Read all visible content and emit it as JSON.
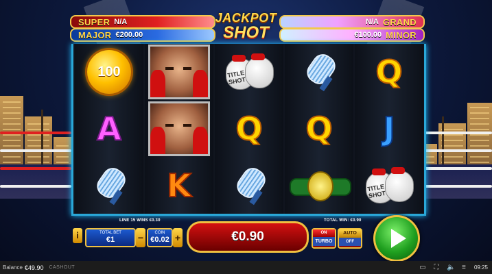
{
  "jackpots": {
    "super": {
      "name": "SUPER",
      "value": "N/A"
    },
    "major": {
      "name": "MAJOR",
      "value": "€200.00"
    },
    "grand": {
      "name": "GRAND",
      "value": "N/A"
    },
    "minor": {
      "name": "MINOR",
      "value": "€100.00"
    }
  },
  "logo": {
    "line1": "JACKPOT",
    "line2": "SHOT"
  },
  "reels": {
    "coin_value": "100",
    "glove_text": "TITLE SHOT",
    "letters": {
      "q": "Q",
      "a": "A",
      "j": "J",
      "k": "K"
    }
  },
  "controls": {
    "info_label": "i",
    "line_info": "LINE 15 WINS €0.30",
    "total_bet_label": "TOTAL BET",
    "total_bet_value": "€1",
    "coin_label": "COIN",
    "coin_value": "€0.02",
    "minus": "−",
    "plus": "+",
    "win_value": "€0.90",
    "total_win": "TOTAL WIN: €0.90",
    "turbo_state": "ON",
    "turbo_label": "TURBO",
    "auto_label": "AUTO",
    "auto_state": "OFF"
  },
  "footer": {
    "balance_label": "Balance",
    "balance_value": "€49.90",
    "brand": "CASHOUT",
    "time": "09:25"
  },
  "colors": {
    "frame": "#2aa8d8",
    "gold": "#f0c040",
    "win_red": "#d41010",
    "spin_green": "#20a020"
  }
}
